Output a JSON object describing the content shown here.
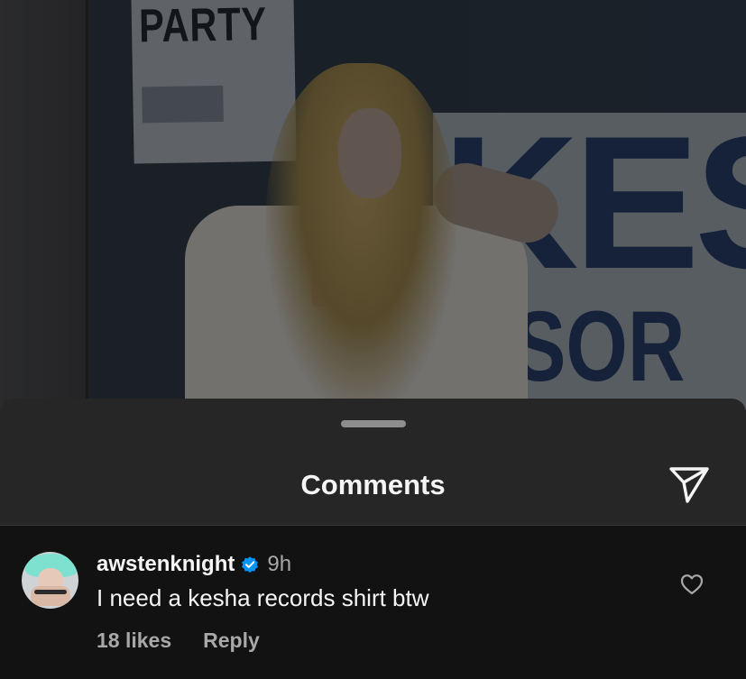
{
  "photo": {
    "sign_text": "PARTY",
    "banner_text_large": "KES",
    "banner_text_small": "SSOR"
  },
  "sheet": {
    "title": "Comments"
  },
  "comment": {
    "username": "awstenknight",
    "verified": true,
    "time_ago": "9h",
    "text": "I need a kesha records shirt btw",
    "likes_label": "18 likes",
    "reply_label": "Reply"
  },
  "icons": {
    "share": "paper-plane-icon",
    "verified": "verified-badge-icon",
    "like": "heart-outline-icon"
  },
  "colors": {
    "sheet_background": "#262626",
    "comment_background": "#121212",
    "verified_blue": "#0095f6",
    "secondary_text": "#a8a8a8"
  }
}
